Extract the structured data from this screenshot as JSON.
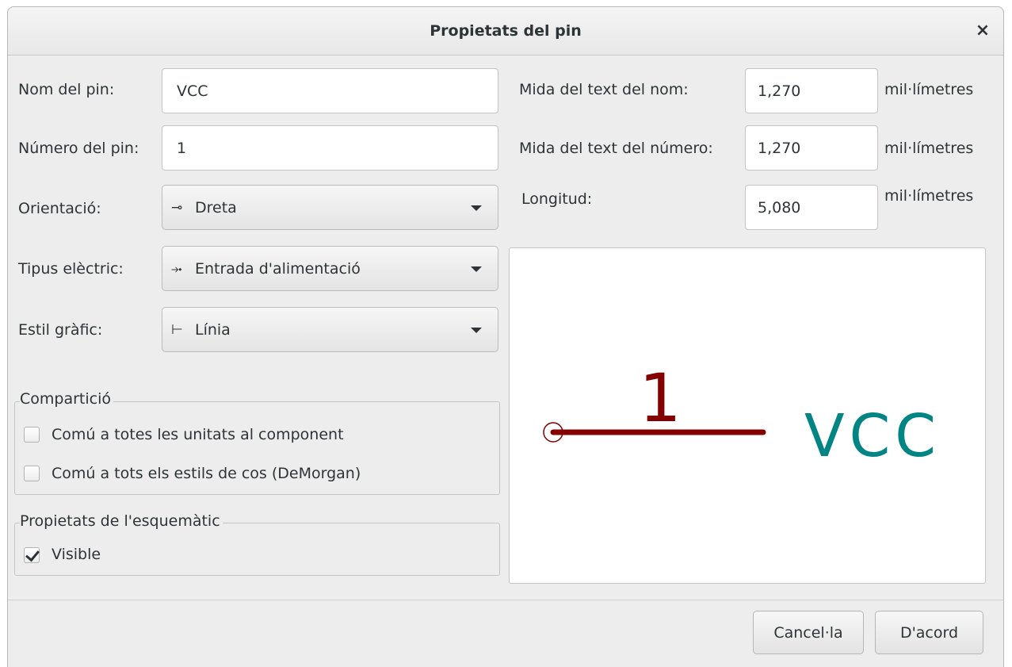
{
  "dialog": {
    "title": "Propietats del pin",
    "close_glyph": "×"
  },
  "left": {
    "pin_name_label": "Nom del pin:",
    "pin_name_value": "VCC",
    "pin_number_label": "Número del pin:",
    "pin_number_value": "1",
    "orientation_label": "Orientació:",
    "orientation_glyph": "⊸",
    "orientation_value": "Dreta",
    "electrical_label": "Tipus elèctric:",
    "electrical_glyph": "⤞",
    "electrical_value": "Entrada d'alimentació",
    "graphic_label": "Estil gràfic:",
    "graphic_glyph": "⊢",
    "graphic_value": "Línia"
  },
  "sharing": {
    "title": "Compartició",
    "common_units": "Comú a totes les unitats al component",
    "common_units_checked": false,
    "common_styles": "Comú a tots els estils de cos (DeMorgan)",
    "common_styles_checked": false
  },
  "schematic": {
    "title": "Propietats de l'esquemàtic",
    "visible": "Visible",
    "visible_checked": true
  },
  "right": {
    "name_size_label": "Mida del text del nom:",
    "name_size_value": "1,270",
    "name_size_unit": "mil·límetres",
    "number_size_label": "Mida del text del número:",
    "number_size_value": "1,270",
    "number_size_unit": "mil·límetres",
    "length_label": "Longitud:",
    "length_value": "5,080",
    "length_unit": "mil·límetres"
  },
  "preview": {
    "pin_number": "1",
    "pin_name": "VCC",
    "pin_color": "#840000",
    "name_color": "#008484"
  },
  "buttons": {
    "cancel": "Cancel·la",
    "ok": "D'acord"
  }
}
